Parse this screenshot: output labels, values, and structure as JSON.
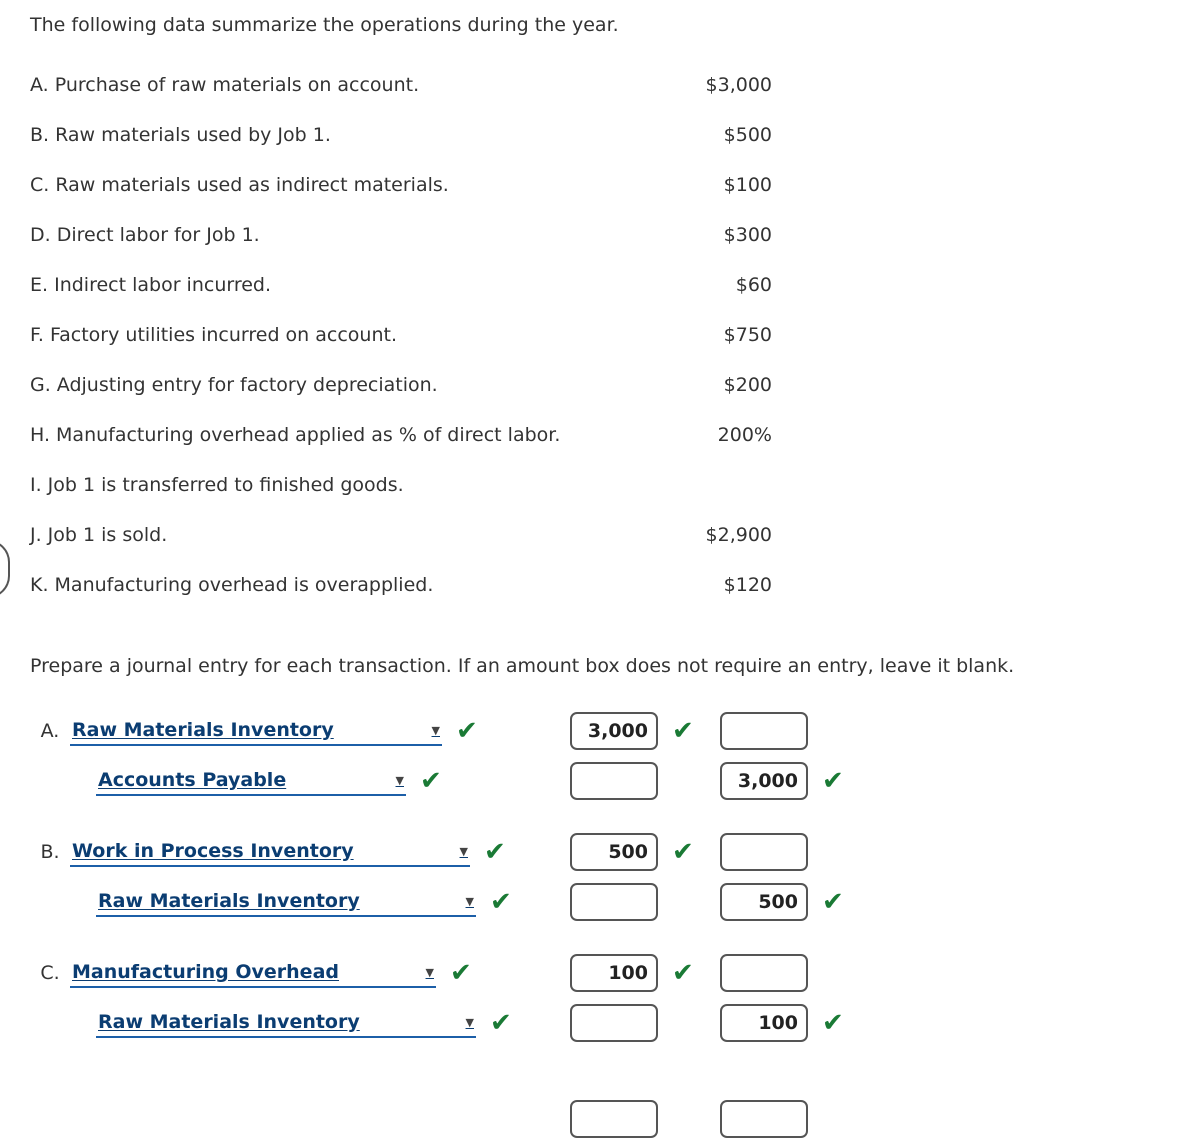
{
  "intro": "The following data summarize the operations during the year.",
  "data_items": [
    {
      "label": "A. Purchase of raw materials on account.",
      "amount": "$3,000"
    },
    {
      "label": "B. Raw materials used by Job 1.",
      "amount": "$500"
    },
    {
      "label": "C. Raw materials used as indirect materials.",
      "amount": "$100"
    },
    {
      "label": "D. Direct labor for Job 1.",
      "amount": "$300"
    },
    {
      "label": "E. Indirect labor incurred.",
      "amount": "$60"
    },
    {
      "label": "F. Factory utilities incurred on account.",
      "amount": "$750"
    },
    {
      "label": "G. Adjusting entry for factory depreciation.",
      "amount": "$200"
    },
    {
      "label": "H. Manufacturing overhead applied as % of direct labor.",
      "amount": "200%"
    },
    {
      "label": "I. Job 1 is transferred to finished goods.",
      "amount": ""
    },
    {
      "label": "J. Job 1 is sold.",
      "amount": "$2,900"
    },
    {
      "label": "K. Manufacturing overhead is overapplied.",
      "amount": "$120"
    }
  ],
  "instruction": "Prepare a journal entry for each transaction. If an amount box does not require an entry, leave it blank.",
  "journal": {
    "caret_glyph": "▼",
    "check_glyph": "✔",
    "entries": [
      {
        "letter": "A.",
        "lines": [
          {
            "account": "Raw Materials Inventory",
            "account_check": "✔",
            "debit": "3,000",
            "debit_check": "✔",
            "credit": "",
            "credit_check": ""
          },
          {
            "account": "Accounts Payable",
            "account_check": "✔",
            "debit": "",
            "debit_check": "",
            "credit": "3,000",
            "credit_check": "✔"
          }
        ]
      },
      {
        "letter": "B.",
        "lines": [
          {
            "account": "Work in Process Inventory",
            "account_check": "✔",
            "debit": "500",
            "debit_check": "✔",
            "credit": "",
            "credit_check": ""
          },
          {
            "account": "Raw Materials Inventory",
            "account_check": "✔",
            "debit": "",
            "debit_check": "",
            "credit": "500",
            "credit_check": "✔"
          }
        ]
      },
      {
        "letter": "C.",
        "lines": [
          {
            "account": "Manufacturing Overhead",
            "account_check": "✔",
            "debit": "100",
            "debit_check": "✔",
            "credit": "",
            "credit_check": ""
          },
          {
            "account": "Raw Materials Inventory",
            "account_check": "✔",
            "debit": "",
            "debit_check": "",
            "credit": "100",
            "credit_check": "✔"
          }
        ]
      }
    ]
  }
}
